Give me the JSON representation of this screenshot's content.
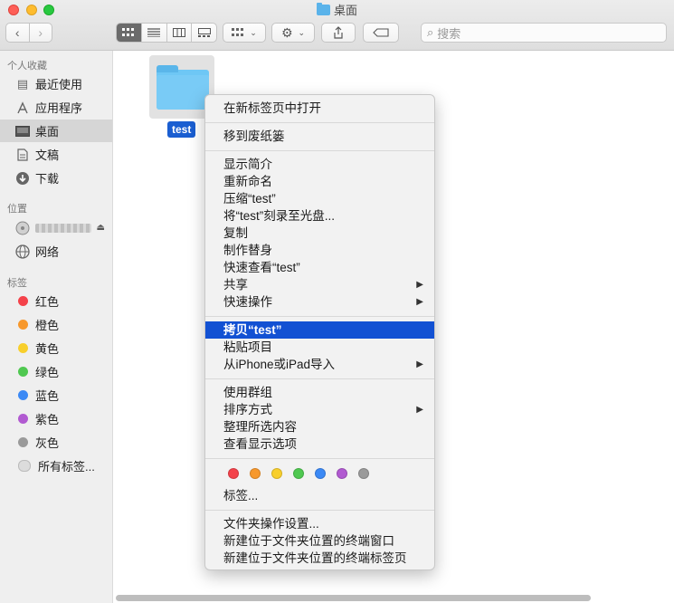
{
  "window": {
    "title": "桌面"
  },
  "toolbar": {
    "back_icon": "chevron-left-icon",
    "forward_icon": "chevron-right-icon",
    "search_placeholder": "搜索"
  },
  "sidebar": {
    "favorites_header": "个人收藏",
    "favorites": [
      {
        "label": "最近使用",
        "icon": "recents-icon"
      },
      {
        "label": "应用程序",
        "icon": "applications-icon"
      },
      {
        "label": "桌面",
        "icon": "desktop-icon"
      },
      {
        "label": "文稿",
        "icon": "documents-icon"
      },
      {
        "label": "下载",
        "icon": "downloads-icon"
      }
    ],
    "locations_header": "位置",
    "locations": [
      {
        "label": "",
        "icon": "disk-icon"
      },
      {
        "label": "网络",
        "icon": "network-icon"
      }
    ],
    "tags_header": "标签",
    "tags": [
      {
        "label": "红色",
        "color": "#f4424a"
      },
      {
        "label": "橙色",
        "color": "#f7982c"
      },
      {
        "label": "黄色",
        "color": "#f8cf2c"
      },
      {
        "label": "绿色",
        "color": "#4fc850"
      },
      {
        "label": "蓝色",
        "color": "#3b89f5"
      },
      {
        "label": "紫色",
        "color": "#b15ad1"
      },
      {
        "label": "灰色",
        "color": "#9a9a9a"
      },
      {
        "label": "所有标签...",
        "color": "#dcdcdc"
      }
    ]
  },
  "content": {
    "file": {
      "name": "test"
    }
  },
  "context_menu": {
    "items": [
      "在新标签页中打开",
      "移到废纸篓",
      "显示简介",
      "重新命名",
      "压缩“test”",
      "将“test”刻录至光盘...",
      "复制",
      "制作替身",
      "快速查看“test”",
      "共享",
      "快速操作",
      "拷贝“test”",
      "粘贴项目",
      "从iPhone或iPad导入",
      "使用群组",
      "排序方式",
      "整理所选内容",
      "查看显示选项",
      "标签...",
      "文件夹操作设置...",
      "新建位于文件夹位置的终端窗口",
      "新建位于文件夹位置的终端标签页"
    ],
    "tag_colors": [
      "#f4424a",
      "#f7982c",
      "#f8cf2c",
      "#4fc850",
      "#3b89f5",
      "#b15ad1",
      "#9a9a9a"
    ]
  }
}
